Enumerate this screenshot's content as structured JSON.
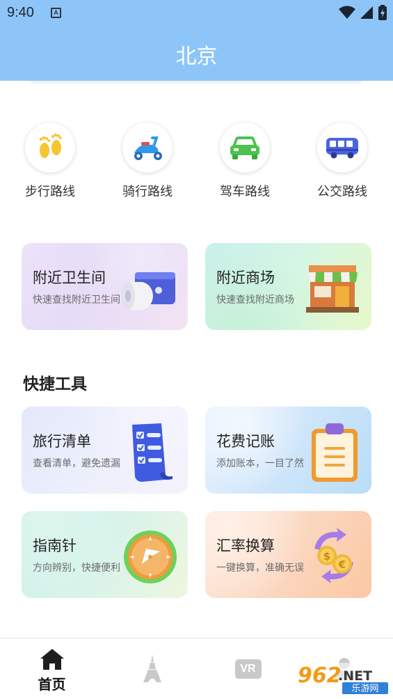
{
  "status_bar": {
    "time": "9:40",
    "a_icon": "A"
  },
  "header": {
    "title": "北京"
  },
  "routes": [
    {
      "label": "步行路线",
      "icon": "footprints-icon"
    },
    {
      "label": "骑行路线",
      "icon": "scooter-icon"
    },
    {
      "label": "驾车路线",
      "icon": "car-icon"
    },
    {
      "label": "公交路线",
      "icon": "bus-icon"
    }
  ],
  "nearby": [
    {
      "title": "附近卫生间",
      "subtitle": "快速查找附近卫生间",
      "icon": "toilet-paper-icon"
    },
    {
      "title": "附近商场",
      "subtitle": "快速查找附近商场",
      "icon": "shop-icon"
    }
  ],
  "tools": {
    "section_title": "快捷工具",
    "items": [
      {
        "title": "旅行清单",
        "subtitle": "查看清单，避免遗漏",
        "icon": "checklist-icon"
      },
      {
        "title": "花费记账",
        "subtitle": "添加账本，一目了然",
        "icon": "clipboard-icon"
      },
      {
        "title": "指南针",
        "subtitle": "方向辨别，快捷便利",
        "icon": "compass-icon"
      },
      {
        "title": "汇率换算",
        "subtitle": "一键换算，准确无误",
        "icon": "currency-exchange-icon"
      }
    ]
  },
  "tabbar": {
    "tabs": [
      {
        "label": "首页",
        "icon": "home-icon",
        "active": true
      },
      {
        "label": "",
        "icon": "tower-icon",
        "active": false
      },
      {
        "label": "",
        "icon": "vr-icon",
        "vr_text": "VR",
        "active": false
      },
      {
        "label": "",
        "icon": "profile-icon",
        "active": false
      }
    ]
  },
  "watermark": {
    "number": "962",
    "suffix": ".NET",
    "caption": "乐游网"
  }
}
